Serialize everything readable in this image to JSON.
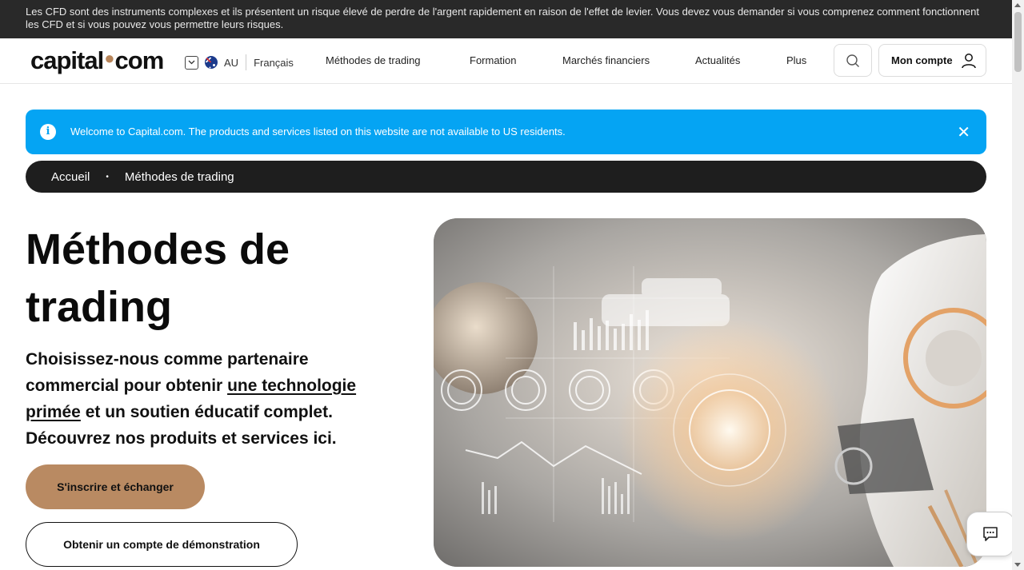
{
  "risk_warning": "Les CFD sont des instruments complexes et ils présentent un risque élevé de perdre de l'argent rapidement en raison de l'effet de levier. Vous devez vous demander si vous comprenez comment fonctionnent les CFD et si vous pouvez vous permettre leurs risques.",
  "header": {
    "logo_left": "capital",
    "logo_dot": "●",
    "logo_right": "com",
    "region": "AU",
    "language": "Français",
    "nav": [
      "Méthodes de trading",
      "Formation",
      "Marchés financiers",
      "Actualités",
      "Plus"
    ],
    "account_label": "Mon compte"
  },
  "banner": {
    "message": "Welcome to Capital.com. The products and services listed on this website are not available to US residents.",
    "info_glyph": "i",
    "close_glyph": "✕"
  },
  "breadcrumb": {
    "items": [
      "Accueil",
      "Méthodes de trading"
    ],
    "separator": "•"
  },
  "hero": {
    "title": "Méthodes de trading",
    "subtitle_before": "Choisissez-nous comme partenaire commercial pour obtenir ",
    "subtitle_link": "une technologie primée",
    "subtitle_after": " et un soutien éducatif complet. Découvrez nos produits et services ici.",
    "primary_cta": "S'inscrire et échanger",
    "secondary_cta": "Obtenir un compte de démonstration"
  },
  "colors": {
    "brand_accent": "#b98a62",
    "banner_blue": "#05a4f3",
    "dark": "#1e1e1e"
  },
  "icons": {
    "search": "search-icon",
    "account": "user-icon",
    "chat": "chat-icon",
    "info": "info-icon",
    "close": "close-icon",
    "chevron": "chevron-down-icon"
  }
}
